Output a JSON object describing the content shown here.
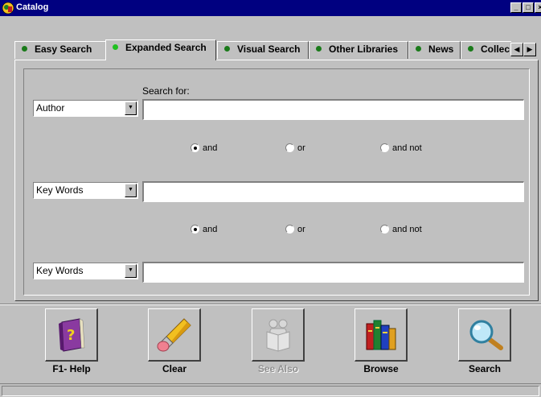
{
  "window": {
    "title": "Catalog"
  },
  "tabs": [
    {
      "label": "Easy Search"
    },
    {
      "label": "Expanded Search"
    },
    {
      "label": "Visual Search"
    },
    {
      "label": "Other Libraries"
    },
    {
      "label": "News"
    },
    {
      "label": "Collec"
    }
  ],
  "search": {
    "search_for_label": "Search for:",
    "rows": [
      {
        "field": "Author",
        "value": ""
      },
      {
        "field": "Key Words",
        "value": ""
      },
      {
        "field": "Key Words",
        "value": ""
      }
    ],
    "operators": [
      {
        "and": "and",
        "or": "or",
        "and_not": "and not",
        "selected": "and"
      },
      {
        "and": "and",
        "or": "or",
        "and_not": "and not",
        "selected": "and"
      }
    ]
  },
  "toolbar": {
    "help_label": "F1- Help",
    "clear_label": "Clear",
    "see_also_label": "See Also",
    "browse_label": "Browse",
    "search_label": "Search"
  },
  "icons": {
    "app": "catalog-icon",
    "help": "help-book-icon",
    "clear": "eraser-icon",
    "see_also": "reader-icon",
    "browse": "books-icon",
    "search": "magnifier-icon"
  },
  "colors": {
    "titlebar": "#000080",
    "face": "#c0c0c0",
    "tab_dot": "#1a7a1a",
    "tab_dot_active": "#20c020"
  }
}
